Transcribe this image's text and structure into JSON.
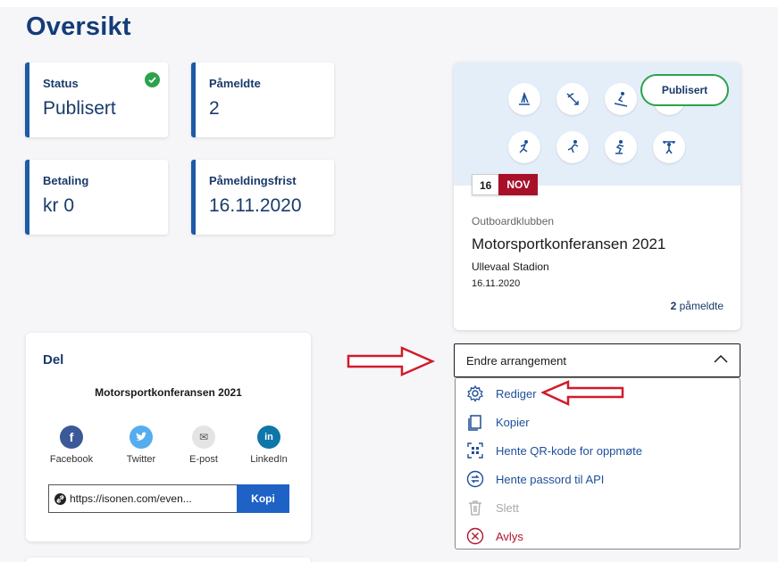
{
  "page": {
    "title": "Oversikt"
  },
  "stats": {
    "status": {
      "label": "Status",
      "value": "Publisert"
    },
    "signups": {
      "label": "Påmeldte",
      "value": "2"
    },
    "payment": {
      "label": "Betaling",
      "value": "kr 0"
    },
    "deadline": {
      "label": "Påmeldingsfrist",
      "value": "16.11.2020"
    }
  },
  "event": {
    "publish_button": "Publisert",
    "day": "16",
    "month": "NOV",
    "organizer": "Outboardklubben",
    "title": "Motorsportkonferansen 2021",
    "venue": "Ullevaal Stadion",
    "date": "16.11.2020",
    "signup_count": "2",
    "signup_suffix": " påmeldte"
  },
  "share": {
    "heading": "Del",
    "event_title": "Motorsportkonferansen 2021",
    "networks": [
      {
        "label": "Facebook",
        "glyph": "f",
        "color": "#3b5998"
      },
      {
        "label": "Twitter",
        "glyph": "t",
        "color": "#55acee"
      },
      {
        "label": "E-post",
        "glyph": "✉",
        "color": "#e4e4e4"
      },
      {
        "label": "LinkedIn",
        "glyph": "in",
        "color": "#0e76a8"
      }
    ],
    "link": "https://isonen.com/even...",
    "copy_button": "Kopi"
  },
  "dropdown": {
    "label": "Endre arrangement",
    "items": [
      {
        "label": "Rediger",
        "icon": "gear-icon"
      },
      {
        "label": "Kopier",
        "icon": "copy-icon"
      },
      {
        "label": "Hente QR-kode for oppmøte",
        "icon": "qr-icon"
      },
      {
        "label": "Hente passord til API",
        "icon": "sync-icon"
      },
      {
        "label": "Slett",
        "icon": "trash-icon"
      },
      {
        "label": "Avlys",
        "icon": "cancel-icon"
      }
    ]
  },
  "colors": {
    "primary": "#1d5aa8",
    "success": "#2aa34a",
    "danger": "#b3142e",
    "annotation_arrow": "#d01c2a"
  }
}
